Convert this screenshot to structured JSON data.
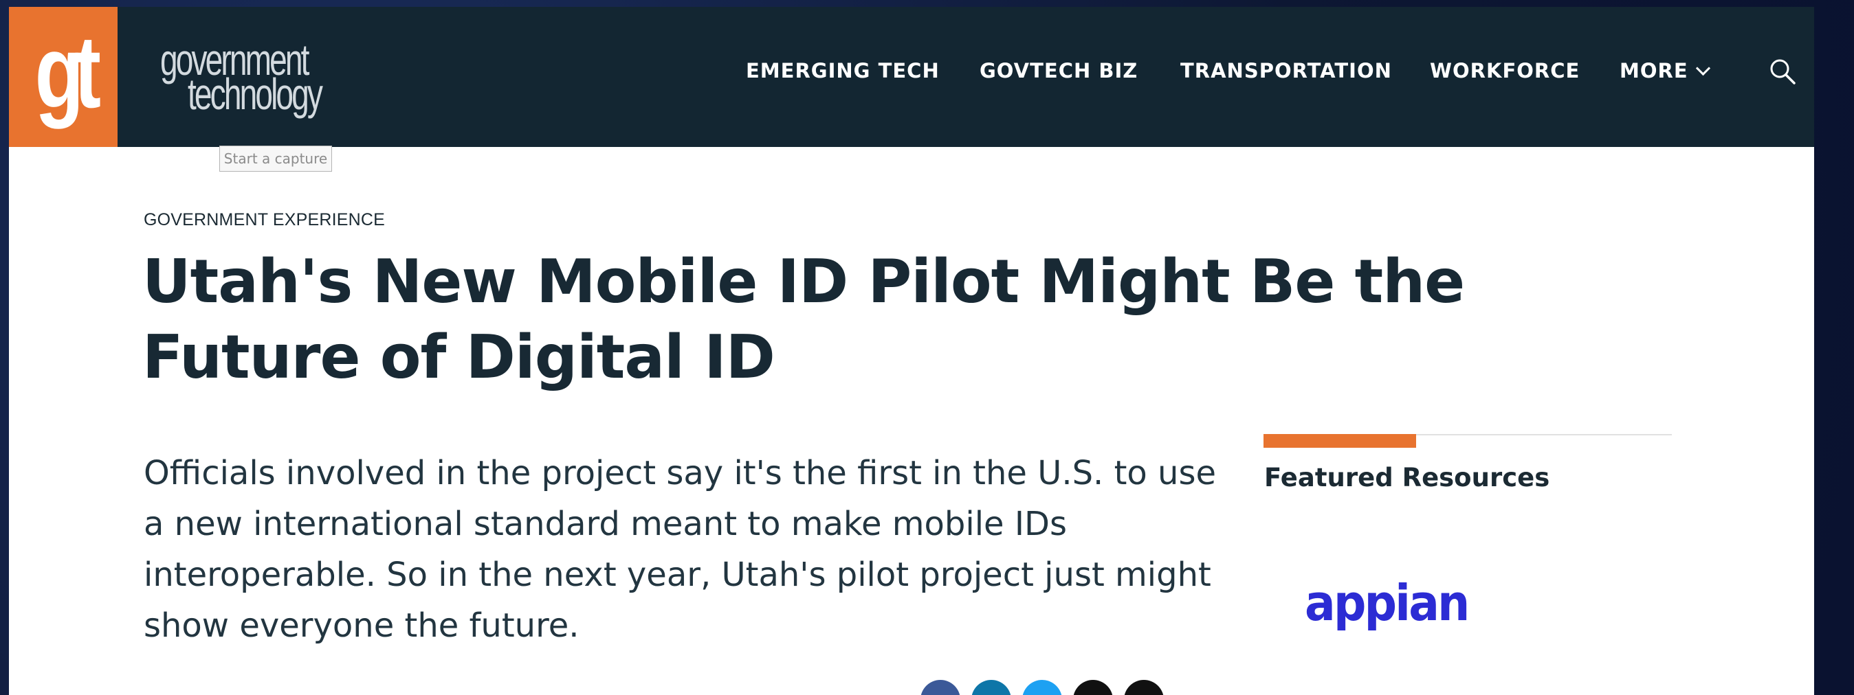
{
  "header": {
    "logo_letters": "gt",
    "wordmark_line1": "government",
    "wordmark_line2": "technology",
    "nav": [
      {
        "label": "EMERGING TECH"
      },
      {
        "label": "GOVTECH BIZ"
      },
      {
        "label": "TRANSPORTATION"
      },
      {
        "label": "WORKFORCE"
      },
      {
        "label": "MORE"
      }
    ],
    "search_icon": "search-icon",
    "more_icon": "chevron-down-icon"
  },
  "tooltip": "Start a capture",
  "article": {
    "category": "GOVERNMENT EXPERIENCE",
    "title": "Utah's New Mobile ID Pilot Might Be the Future of Digital ID",
    "lede": "Officials involved in the project say it's the first in the U.S. to use a new international standard meant to make mobile IDs interoperable. So in the next year, Utah's pilot project just might show everyone the future."
  },
  "sidebar": {
    "title": "Featured Resources",
    "sponsor_logo": "appian"
  },
  "share_icons": [
    "facebook-icon",
    "linkedin-icon",
    "twitter-icon",
    "email-icon",
    "print-icon"
  ],
  "colors": {
    "brand_orange": "#e8732f",
    "header_bg": "#132632",
    "text_dark": "#182934",
    "appian_blue": "#2c2cd4"
  }
}
